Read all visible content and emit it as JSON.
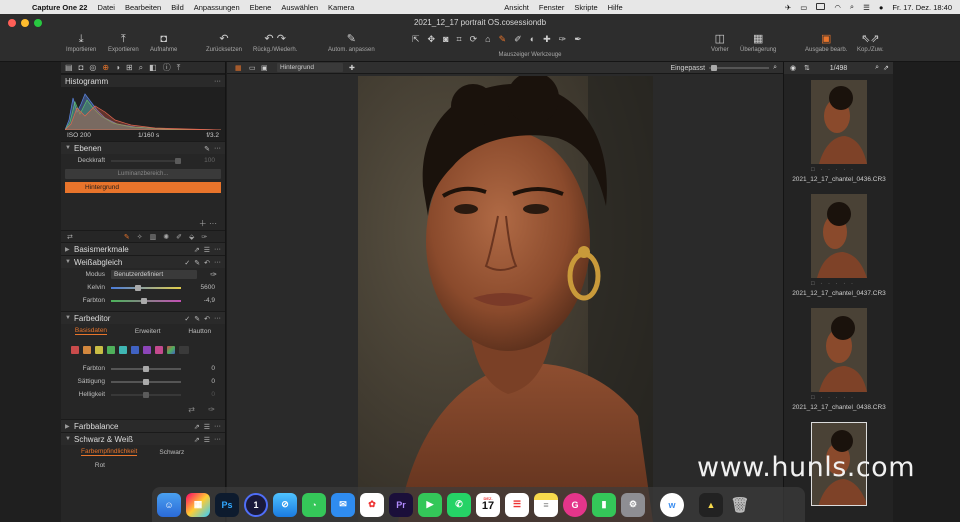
{
  "menubar": {
    "app_name": "Capture One 22",
    "items": [
      "Datei",
      "Bearbeiten",
      "Bild",
      "Anpassungen",
      "Ebene",
      "Auswählen",
      "Kamera",
      "Ansicht",
      "Fenster",
      "Skripte",
      "Hilfe"
    ],
    "clock": "Fr. 17. Dez.  18:40"
  },
  "window": {
    "title": "2021_12_17 portrait OS.cosessiondb"
  },
  "toolbar": {
    "import": "Importieren",
    "export": "Exportieren",
    "capture": "Aufnahme",
    "reset": "Zurücksetzen",
    "undo_redo": "Rückg./Wiederh.",
    "auto_adjust": "Autom. anpassen",
    "cursor_tools": "Mauszeiger Werkzeuge",
    "before": "Vorher",
    "overlay": "Überlagerung",
    "output": "Ausgabe bearb.",
    "copy_apply": "Kop./Zuw."
  },
  "histogram": {
    "title": "Histogramm",
    "iso": "ISO 200",
    "shutter": "1/160 s",
    "aperture": "f/3.2"
  },
  "layers": {
    "title": "Ebenen",
    "opacity_label": "Deckkraft",
    "opacity_value": "100",
    "luminance_button": "Luminanzbereich...",
    "active_layer": "Hintergrund"
  },
  "sections": {
    "basic": "Basismerkmale",
    "white_balance": "Weißabgleich",
    "color_editor": "Farbeditor",
    "color_balance": "Farbbalance",
    "bw": "Schwarz & Weiß"
  },
  "white_balance": {
    "mode_label": "Modus",
    "mode_value": "Benutzerdefiniert",
    "kelvin_label": "Kelvin",
    "kelvin_value": "5600",
    "tint_label": "Farbton",
    "tint_value": "-4,9"
  },
  "color_editor": {
    "tabs": [
      "Basisdaten",
      "Erweitert",
      "Hautton"
    ],
    "hue_label": "Farbton",
    "hue_value": "0",
    "saturation_label": "Sättigung",
    "saturation_value": "0",
    "lightness_label": "Helligkeit",
    "lightness_value": "0"
  },
  "bw": {
    "tab": "Farbempfindlichkeit",
    "field": "Schwarz",
    "red_label": "Rot"
  },
  "viewer": {
    "layer_select": "Hintergrund",
    "fit_label": "Eingepasst"
  },
  "browser": {
    "count": "1/498",
    "thumbs": [
      "2021_12_17_chantel_0436.CR3",
      "2021_12_17_chantel_0437.CR3",
      "2021_12_17_chantel_0438.CR3"
    ]
  },
  "dock": {
    "apps": [
      "finder",
      "launchpad",
      "photoshop",
      "1password",
      "safari",
      "messages",
      "mail",
      "photos",
      "premiere",
      "facetime",
      "whatsapp",
      "calendar",
      "reminders",
      "notes",
      "grammarly",
      "numbers",
      "system-preferences",
      "webflow",
      "vectorworks",
      "trash"
    ],
    "calendar_day": "17",
    "calendar_month": "DEZ."
  },
  "watermark": "www.hunls.com",
  "colors": {
    "accent": "#e8742b",
    "panel": "#262626",
    "toolbar": "#2d2d2d"
  }
}
